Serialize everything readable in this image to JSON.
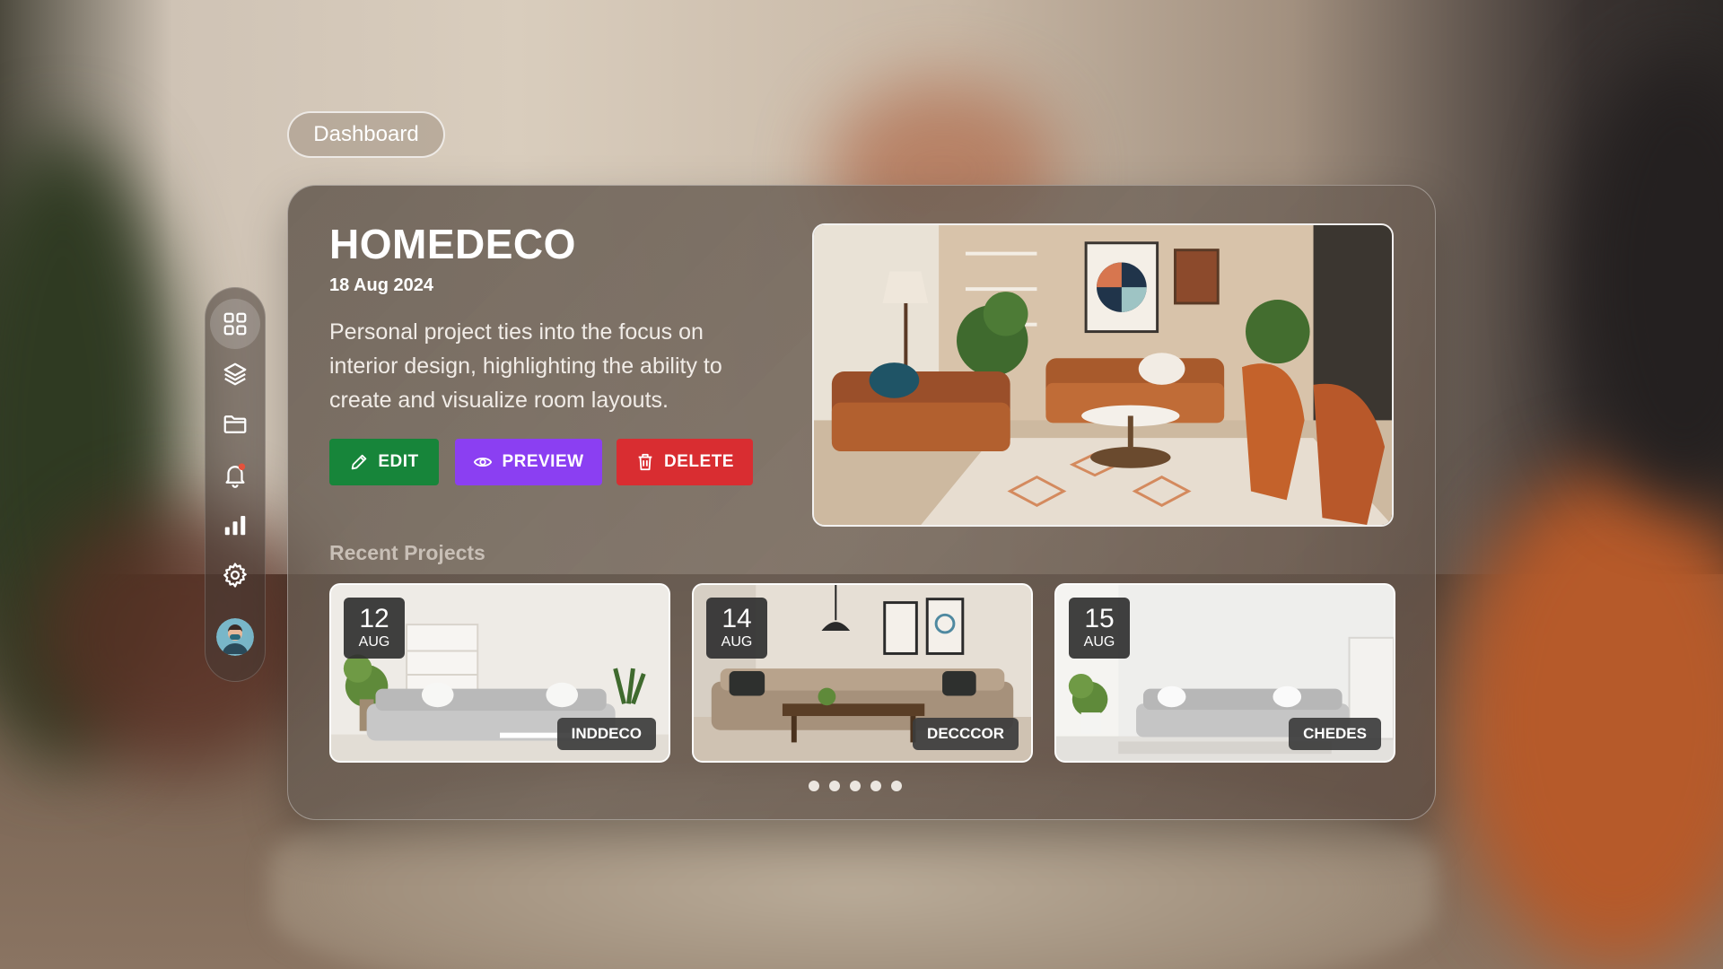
{
  "nav": {
    "dashboard_label": "Dashboard"
  },
  "sidebar": {
    "items": [
      {
        "icon": "grid-icon",
        "active": true
      },
      {
        "icon": "layers-icon"
      },
      {
        "icon": "folder-icon"
      },
      {
        "icon": "bell-icon",
        "has_notification": true
      },
      {
        "icon": "bar-chart-icon"
      },
      {
        "icon": "gear-icon"
      }
    ],
    "avatar": "user-avatar"
  },
  "project": {
    "title": "HOMEDECO",
    "date": "18 Aug 2024",
    "description": "Personal project ties into the focus on interior design, highlighting the ability to create and visualize room layouts.",
    "actions": {
      "edit_label": "EDIT",
      "preview_label": "PREVIEW",
      "delete_label": "DELETE"
    }
  },
  "recent": {
    "heading": "Recent Projects",
    "items": [
      {
        "day": "12",
        "month": "AUG",
        "name": "INDDECO"
      },
      {
        "day": "14",
        "month": "AUG",
        "name": "DECCCOR"
      },
      {
        "day": "15",
        "month": "AUG",
        "name": "CHEDES"
      }
    ],
    "pagination_count": 5
  },
  "colors": {
    "edit": "#17853a",
    "preview": "#8b3ff2",
    "delete": "#d92d31",
    "notification": "#e5533d"
  }
}
